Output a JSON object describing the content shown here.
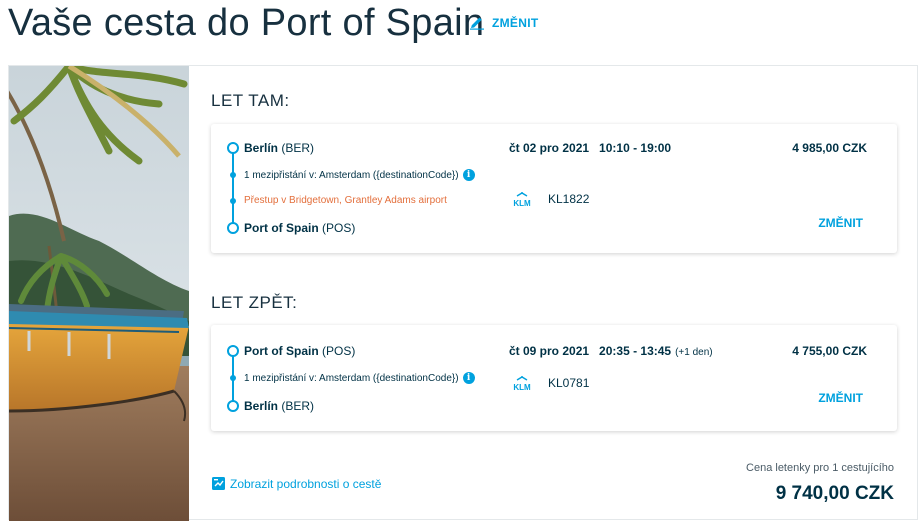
{
  "header": {
    "title": "Vaše cesta do Port of Spain",
    "edit_label": "ZMĚNIT"
  },
  "outbound": {
    "section_label": "LET TAM:",
    "origin_city": "Berlín",
    "origin_code": "(BER)",
    "stop_text": "1 mezipřistání v: Amsterdam ({destinationCode})",
    "transfer_text": "Přestup v Bridgetown, Grantley Adams airport",
    "destination_city": "Port of Spain",
    "destination_code": "(POS)",
    "date": "čt 02 pro 2021",
    "time": "10:10 - 19:00",
    "airline": "KLM",
    "flight_number": "KL1822",
    "price": "4 985,00 CZK",
    "change_label": "ZMĚNIT"
  },
  "return": {
    "section_label": "LET ZPĚT:",
    "origin_city": "Port of Spain",
    "origin_code": "(POS)",
    "stop_text": "1 mezipřistání v: Amsterdam ({destinationCode})",
    "destination_city": "Berlín",
    "destination_code": "(BER)",
    "date": "čt 09 pro 2021",
    "time": "20:35 - 13:45",
    "plus_day": "(+1 den)",
    "airline": "KLM",
    "flight_number": "KL0781",
    "price": "4 755,00 CZK",
    "change_label": "ZMĚNIT"
  },
  "footer": {
    "details_link": "Zobrazit podrobnosti o cestě",
    "total_label": "Cena letenky pro 1 cestujícího",
    "total_value": "9 740,00 CZK"
  },
  "icons": {
    "edit": "pencil-icon",
    "info": "info-icon",
    "details": "itinerary-icon",
    "airline": "klm-logo"
  },
  "colors": {
    "accent": "#00a1de",
    "text": "#003145",
    "transfer": "#e36f3c",
    "klm": "#00a1de"
  }
}
